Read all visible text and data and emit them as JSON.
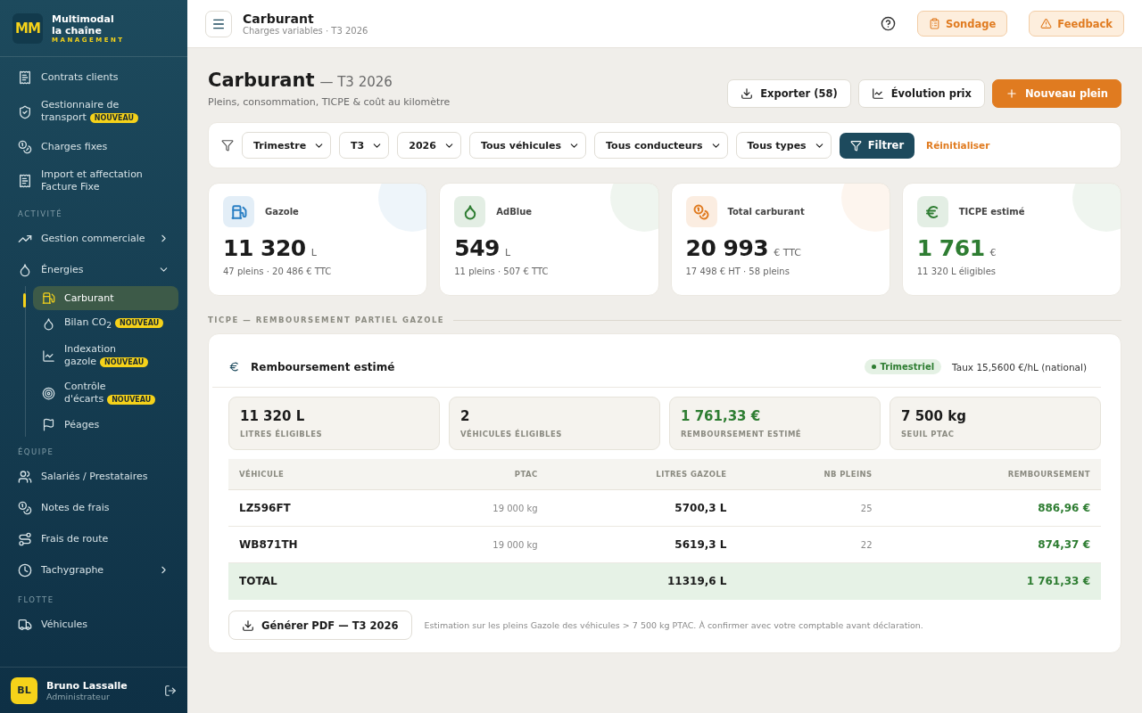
{
  "brand": {
    "logo": "MM",
    "name_line1": "Multimodal",
    "name_line2": "la chaîne",
    "tagline": "MANAGEMENT"
  },
  "sidebar": {
    "items": [
      {
        "kind": "item",
        "label": "Contrats clients"
      },
      {
        "kind": "item",
        "label": "Gestionnaire de transport",
        "badge": "NOUVEAU"
      },
      {
        "kind": "item",
        "label": "Charges fixes"
      },
      {
        "kind": "item",
        "label": "Import et affectation Facture Fixe"
      },
      {
        "kind": "section",
        "label": "ACTIVITÉ"
      },
      {
        "kind": "item",
        "label": "Gestion commerciale",
        "expanded": false
      },
      {
        "kind": "item",
        "label": "Énergies",
        "expanded": true,
        "children": [
          {
            "label": "Carburant",
            "selected": true
          },
          {
            "label": "Bilan CO$_{2}$",
            "badge": "NOUVEAU",
            "selected": false
          },
          {
            "label": "Indexation gazole",
            "badge": "NOUVEAU",
            "selected": false
          },
          {
            "label": "Contrôle d'écarts",
            "badge": "NOUVEAU",
            "selected": false
          },
          {
            "label": "Péages",
            "selected": false
          }
        ]
      },
      {
        "kind": "section",
        "label": "ÉQUIPE"
      },
      {
        "kind": "item",
        "label": "Salariés / Prestataires"
      },
      {
        "kind": "item",
        "label": "Notes de frais"
      },
      {
        "kind": "item",
        "label": "Frais de route"
      },
      {
        "kind": "item",
        "label": "Tachygraphe",
        "expanded": false
      },
      {
        "kind": "section",
        "label": "FLOTTE"
      },
      {
        "kind": "item",
        "label": "Véhicules"
      }
    ]
  },
  "user": {
    "initials": "BL",
    "name": "Bruno Lassalle",
    "role": "Administrateur"
  },
  "topbar": {
    "title": "Carburant",
    "breadcrumb": "Charges variables · T3 2026",
    "buttons": [
      "Sondage",
      "Feedback"
    ]
  },
  "page": {
    "title": "Carburant",
    "period": "— T3 2026",
    "subtitle": "Pleins, consommation, TICPE & coût au kilomètre",
    "actions": [
      {
        "kind": "export",
        "label": "Exporter (58)"
      },
      {
        "kind": "chart",
        "label": "Évolution prix"
      },
      {
        "kind": "primary",
        "label": "Nouveau plein"
      }
    ]
  },
  "filters": {
    "selects": [
      "Trimestre",
      "T3",
      "2026",
      "Tous véhicules",
      "Tous conducteurs",
      "Tous types"
    ],
    "apply": "Filtrer",
    "reset": "Réinitialiser"
  },
  "kpis": [
    {
      "label": "Gazole",
      "value": "11 320",
      "unit": "L",
      "detail": "47 pleins · 20 486 € TTC",
      "color": "#2a7fc4",
      "highlight": false
    },
    {
      "label": "AdBlue",
      "value": "549",
      "unit": "L",
      "detail": "11 pleins · 507 € TTC",
      "color": "#2e7d32",
      "highlight": false
    },
    {
      "label": "Total carburant",
      "value": "20 993",
      "unit": "€ TTC",
      "detail": "17 498 € HT · 58 pleins",
      "color": "#e07b20",
      "highlight": false
    },
    {
      "label": "TICPE estimé",
      "value": "1 761",
      "unit": "€",
      "detail": "11 320 L éligibles",
      "color": "#2e7d32",
      "highlight": true
    }
  ],
  "ticpe": {
    "section_title": "TICPE — REMBOURSEMENT PARTIEL GAZOLE",
    "card_title": "Remboursement estimé",
    "badge": "Trimestriel",
    "rate": "Taux 15,5600 €/hL (national)",
    "stats": [
      {
        "value": "11 320 L",
        "label": "LITRES ÉLIGIBLES",
        "highlight": false
      },
      {
        "value": "2",
        "label": "VÉHICULES ÉLIGIBLES",
        "highlight": false
      },
      {
        "value": "1 761,33 €",
        "label": "REMBOURSEMENT ESTIMÉ",
        "highlight": true
      },
      {
        "value": "7 500 kg",
        "label": "SEUIL PTAC",
        "highlight": false
      }
    ],
    "table": {
      "columns": [
        "VÉHICULE",
        "PTAC",
        "LITRES GAZOLE",
        "NB PLEINS",
        "REMBOURSEMENT"
      ],
      "rows": [
        {
          "kind": "row",
          "cells": [
            "LZ596FT",
            "19 000 kg",
            "5700,3 L",
            "25",
            "886,96 €"
          ]
        },
        {
          "kind": "row",
          "cells": [
            "WB871TH",
            "19 000 kg",
            "5619,3 L",
            "22",
            "874,37 €"
          ]
        },
        {
          "kind": "total",
          "cells": [
            "TOTAL",
            "",
            "11319,6 L",
            "",
            "1 761,33 €"
          ]
        }
      ]
    },
    "pdf_button": "Générer PDF — T3 2026",
    "note": "Estimation sur les pleins Gazole des véhicules > 7 500 kg PTAC. À confirmer avec votre comptable avant déclaration."
  }
}
